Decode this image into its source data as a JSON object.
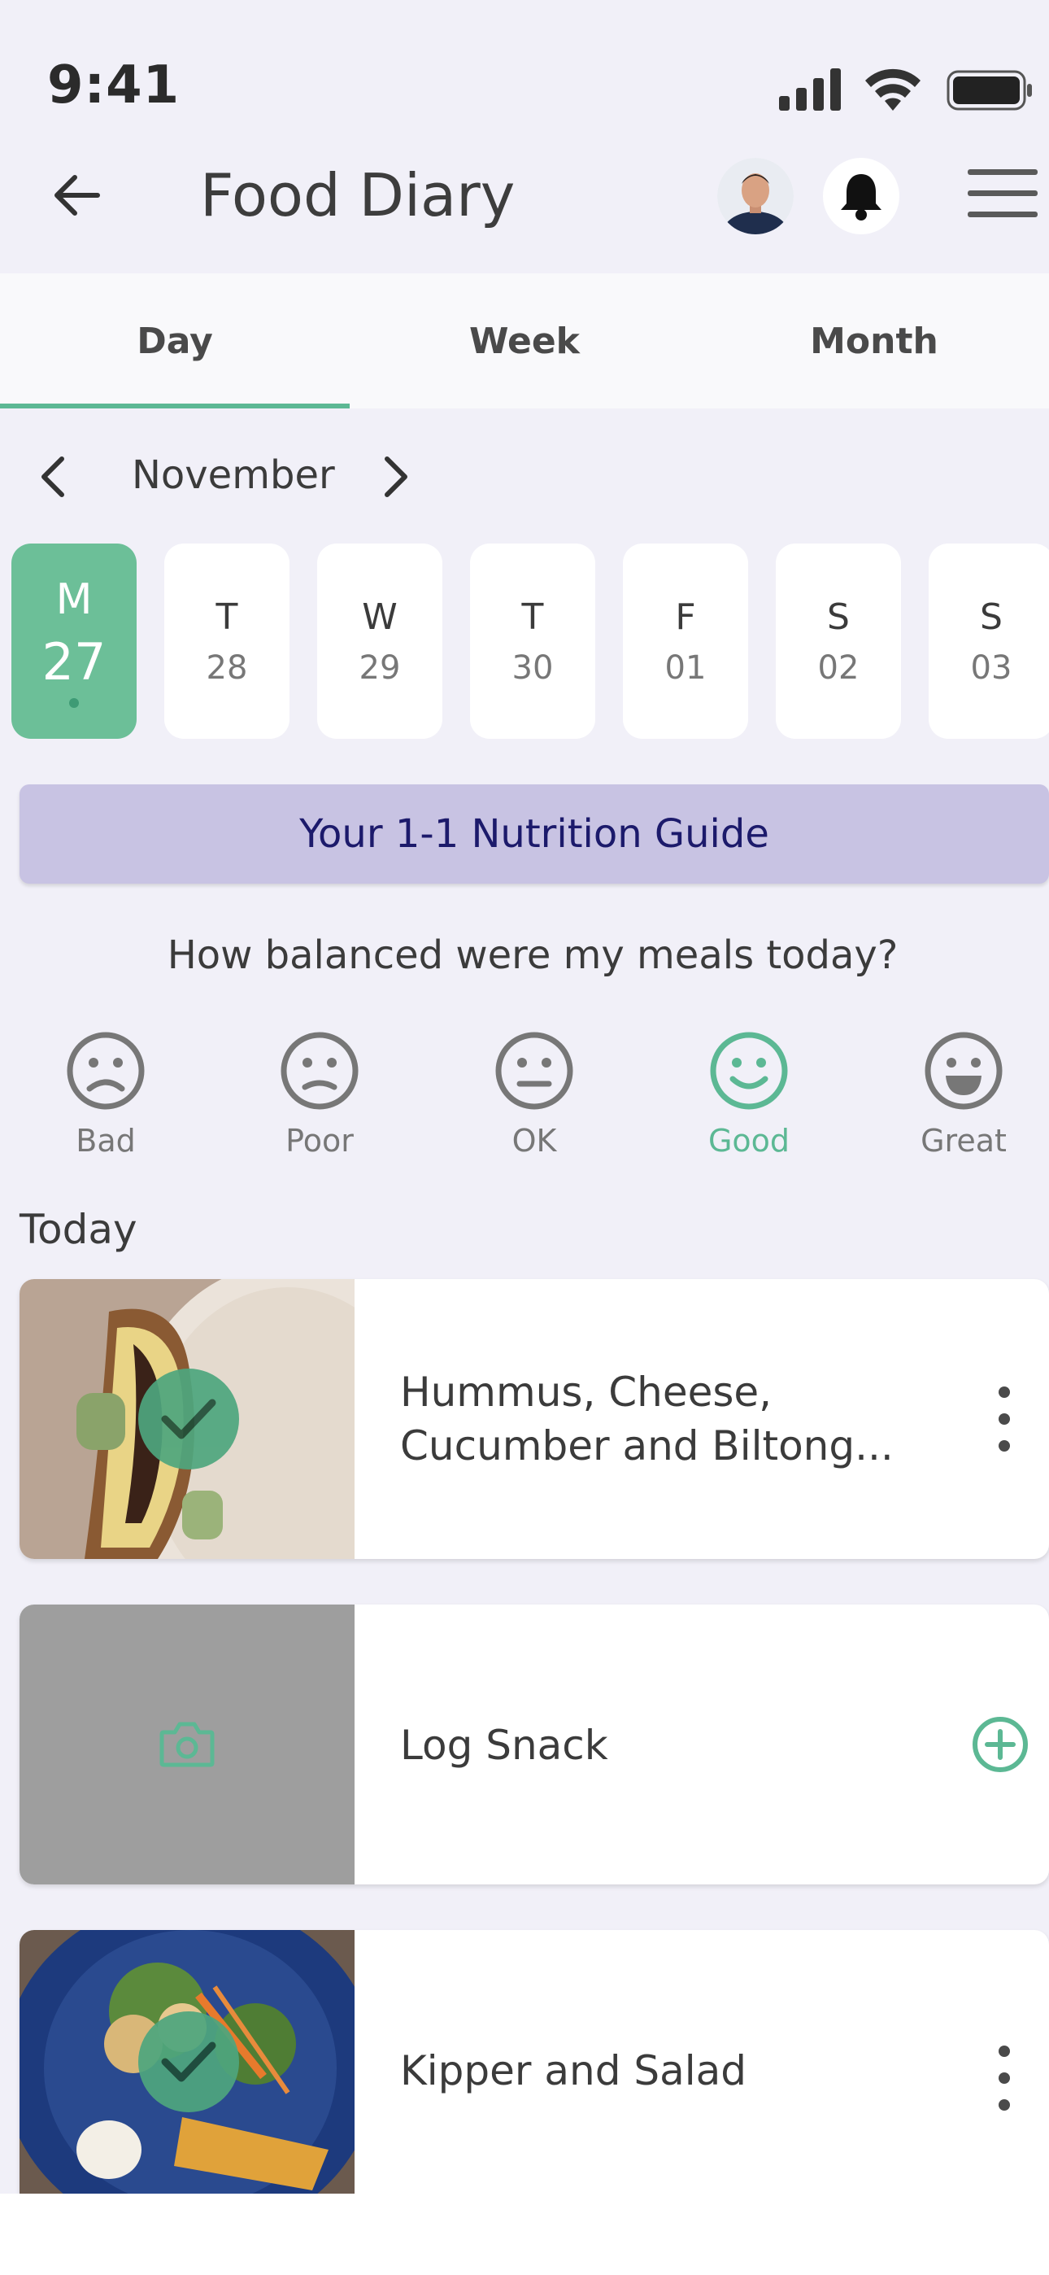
{
  "status_bar": {
    "time": "9:41"
  },
  "header": {
    "title": "Food Diary"
  },
  "tabs": [
    {
      "label": "Day",
      "active": true
    },
    {
      "label": "Week",
      "active": false
    },
    {
      "label": "Month",
      "active": false
    }
  ],
  "calendar": {
    "month": "November",
    "days": [
      {
        "letter": "M",
        "num": "27",
        "selected": true
      },
      {
        "letter": "T",
        "num": "28"
      },
      {
        "letter": "W",
        "num": "29"
      },
      {
        "letter": "T",
        "num": "30"
      },
      {
        "letter": "F",
        "num": "01"
      },
      {
        "letter": "S",
        "num": "02"
      },
      {
        "letter": "S",
        "num": "03"
      }
    ]
  },
  "banner": {
    "label": "Your 1-1 Nutrition Guide"
  },
  "balance": {
    "question": "How balanced were my meals today?",
    "options": [
      {
        "label": "Bad"
      },
      {
        "label": "Poor"
      },
      {
        "label": "OK"
      },
      {
        "label": "Good",
        "selected": true
      },
      {
        "label": "Great"
      }
    ]
  },
  "section_title": "Today",
  "meals": [
    {
      "name_line1": "Hummus, Cheese,",
      "name_line2": "Cucumber and Biltong...",
      "logged": true
    },
    {
      "name": "Log Snack",
      "logged": false
    },
    {
      "name": "Kipper and Salad",
      "logged": true
    }
  ],
  "colors": {
    "accent": "#5cb894",
    "banner": "#c8c3e3",
    "banner_text": "#1c1a6b",
    "background": "#f1f0f8"
  }
}
